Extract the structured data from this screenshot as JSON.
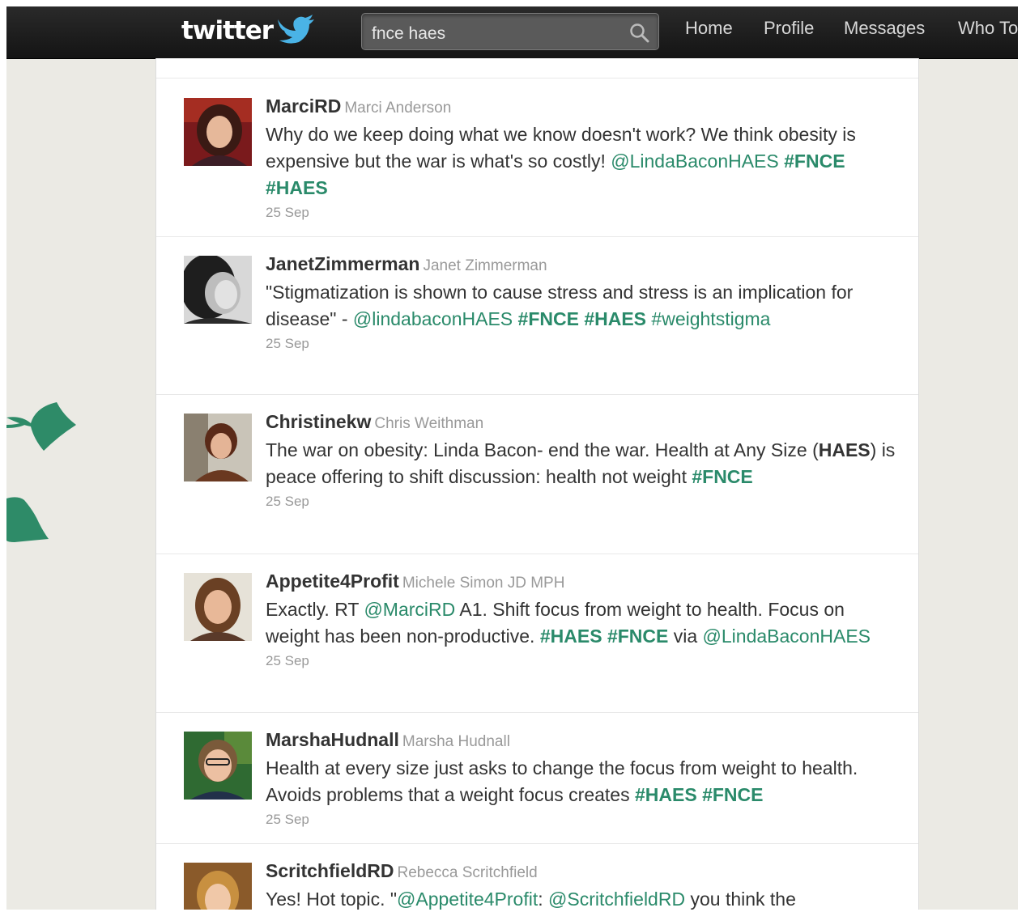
{
  "topbar": {
    "logo_text": "twitter",
    "search_value": "fnce haes",
    "nav": [
      "Home",
      "Profile",
      "Messages",
      "Who To"
    ]
  },
  "colors": {
    "topbar": "#1a1a1a",
    "background": "#ebeae4",
    "link": "#2a8a6a",
    "bird": "#4ab3e6"
  },
  "tweets": [
    {
      "screen_name": "MarciRD",
      "full_name": "Marci Anderson",
      "time": "25 Sep",
      "text": [
        {
          "t": "Why do we keep doing what we know doesn't work? We think obesity is expensive but the war is what's so costly! "
        },
        {
          "t": "@LindaBaconHAES",
          "k": "mention"
        },
        {
          "t": " "
        },
        {
          "t": "#FNCE",
          "k": "hashtag"
        },
        {
          "t": " "
        },
        {
          "t": "#HAES",
          "k": "hashtag"
        }
      ]
    },
    {
      "screen_name": "JanetZimmerman",
      "full_name": "Janet Zimmerman",
      "time": "25 Sep",
      "text": [
        {
          "t": "\"Stigmatization is shown to cause stress and stress is an implication for disease\" - "
        },
        {
          "t": "@lindabaconHAES",
          "k": "mention"
        },
        {
          "t": " "
        },
        {
          "t": "#FNCE",
          "k": "hashtag"
        },
        {
          "t": " "
        },
        {
          "t": "#HAES",
          "k": "hashtag"
        },
        {
          "t": " "
        },
        {
          "t": "#weightstigma",
          "k": "mention"
        }
      ]
    },
    {
      "screen_name": "Christinekw",
      "full_name": "Chris Weithman",
      "time": "25 Sep",
      "text": [
        {
          "t": "The war on obesity: Linda Bacon- end the war. Health at Any Size ("
        },
        {
          "t": "HAES",
          "k": "bold"
        },
        {
          "t": ") is peace offering to shift discussion: health not weight "
        },
        {
          "t": "#FNCE",
          "k": "hashtag"
        }
      ]
    },
    {
      "screen_name": "Appetite4Profit",
      "full_name": "Michele Simon JD MPH",
      "time": "25 Sep",
      "text": [
        {
          "t": "Exactly. RT "
        },
        {
          "t": "@MarciRD",
          "k": "mention"
        },
        {
          "t": " A1. Shift focus from weight to health. Focus on weight has been non-productive. "
        },
        {
          "t": "#HAES",
          "k": "hashtag"
        },
        {
          "t": " "
        },
        {
          "t": "#FNCE",
          "k": "hashtag"
        },
        {
          "t": " via "
        },
        {
          "t": "@LindaBaconHAES",
          "k": "mention"
        }
      ]
    },
    {
      "screen_name": "MarshaHudnall",
      "full_name": "Marsha Hudnall",
      "time": "25 Sep",
      "text": [
        {
          "t": "Health at every size just asks to change the focus from weight to health. Avoids problems that a weight focus creates "
        },
        {
          "t": "#HAES",
          "k": "hashtag"
        },
        {
          "t": " "
        },
        {
          "t": "#FNCE",
          "k": "hashtag"
        }
      ]
    },
    {
      "screen_name": "ScritchfieldRD",
      "full_name": "Rebecca Scritchfield",
      "time": "",
      "text": [
        {
          "t": "Yes! Hot topic. \""
        },
        {
          "t": "@Appetite4Profit",
          "k": "mention"
        },
        {
          "t": ": "
        },
        {
          "t": "@ScritchfieldRD",
          "k": "mention"
        },
        {
          "t": " you think the"
        }
      ]
    }
  ]
}
